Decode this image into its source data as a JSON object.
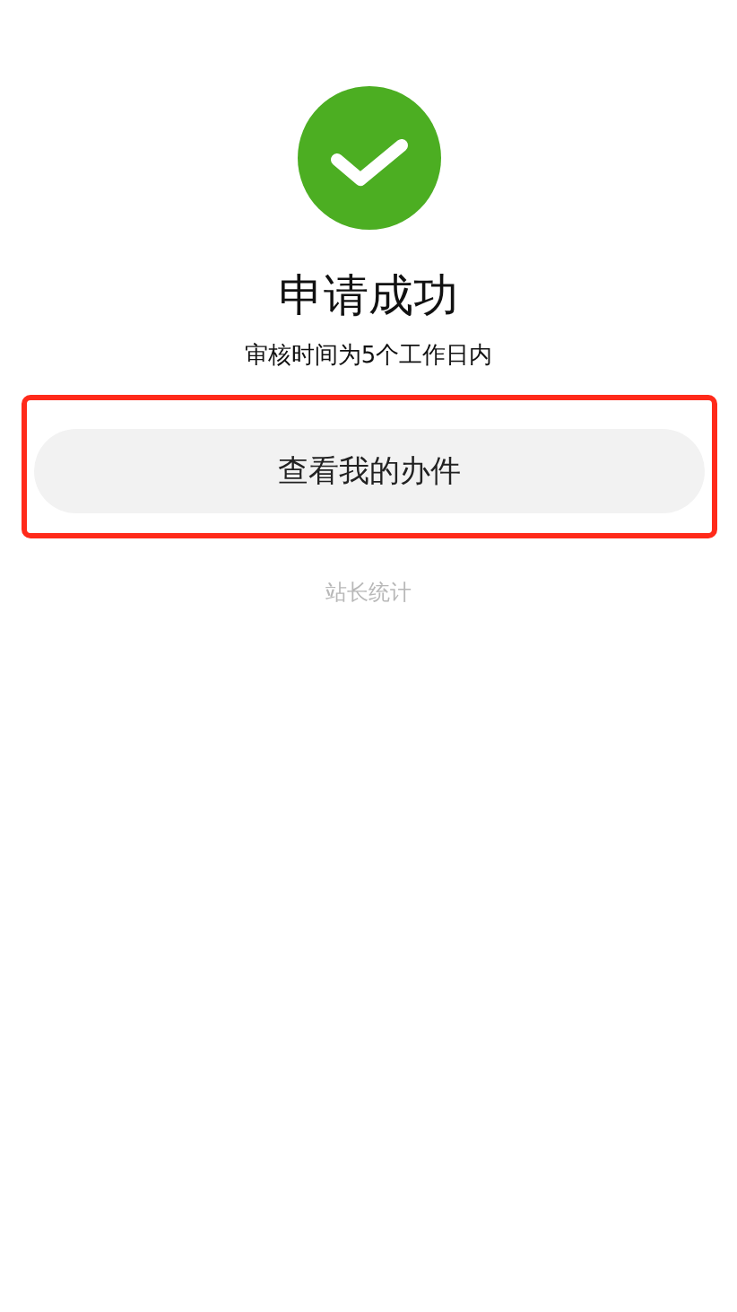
{
  "status": {
    "title": "申请成功",
    "subtitle": "审核时间为5个工作日内"
  },
  "highlight": {
    "on": true
  },
  "button": {
    "label": "查看我的办件"
  },
  "footer_link": "站长统计"
}
